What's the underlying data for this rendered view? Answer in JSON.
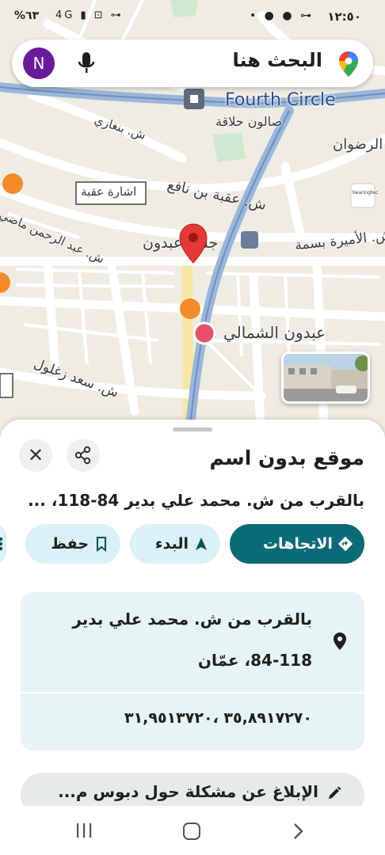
{
  "status_bar": {
    "time": "١٢:٥٠",
    "battery": "%٦٣",
    "right_icons": "• ● ● ⊶",
    "left_icons": "4G ▮ ⊡ ⊶"
  },
  "search": {
    "placeholder": "البحث هنا",
    "avatar_letter": "N"
  },
  "map": {
    "labels": {
      "fourth_circle": "Fourth Circle",
      "salon": "صالون حلاقة",
      "banghazi": "ش. بنغازي",
      "al_radwan": "الرضوان",
      "traffic_light": "اشارة عقبة",
      "uqba_st": "ش. عقبة بن نافع",
      "abdoun_bridge": "جسر عبدون",
      "princess_basma": "ش. الأميرة بسمة",
      "abdulrahman": "ش. عبد الرحمن ماضي",
      "abdoun_north": "عبدون الشمالي",
      "saad_zaghloul": "ش. سعد زغلول",
      "nafi_fragment": "نافع",
      "bearingtec": "bearingtec"
    }
  },
  "sheet": {
    "title": "موقع بدون اسم",
    "subtitle": "بالقرب من ش. محمد علي بدير 84-118، ...",
    "actions": {
      "directions": "الاتجاهات",
      "start": "البدء",
      "save": "حفظ"
    },
    "address_line1": "بالقرب من ش. محمد علي بدير",
    "address_line2": "84-118، عمّان",
    "coordinates": "٣٥,٨٩١٧٢٧٠ ،٣١,٩٥١٣٧٢٠",
    "report": "الإبلاغ عن مشكلة حول دبوس م..."
  },
  "colors": {
    "accent": "#0b6a77",
    "chip_bg": "#d9f1f7",
    "card_bg": "#e6f4f3",
    "pin": "#e53935",
    "avatar": "#6a1b9a"
  }
}
